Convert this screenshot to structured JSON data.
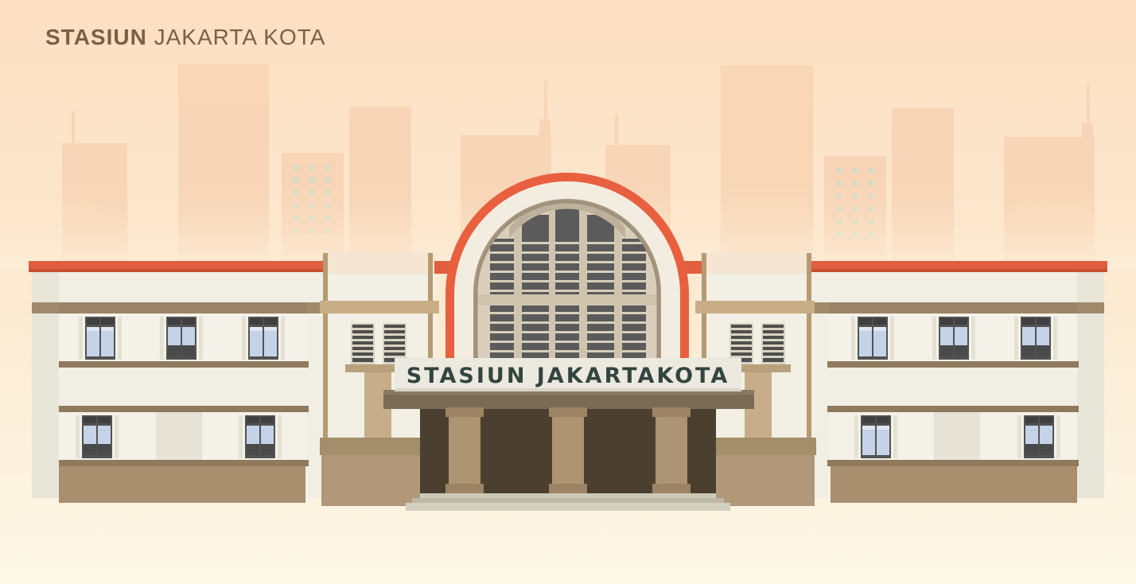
{
  "title": {
    "bold": "STASIUN",
    "light": "JAKARTA KOTA"
  },
  "sign": {
    "text": "STASIUN JAKARTAKOTA"
  },
  "colors": {
    "sky_top": "#fde0c2",
    "sky_bottom": "#fdf8e8",
    "skyline": "#f7d3b3",
    "roof_red": "#e05f40",
    "wall": "#f2efe3",
    "trim_brown": "#a18a6b",
    "plinth": "#ad9674",
    "entrance_dark": "#4a3f2c",
    "pillar": "#ad9573",
    "sign_bg": "#eceae0",
    "sign_text": "#34453f",
    "title_text": "#7b5f42",
    "window_glass": "#c3d2e7",
    "window_frame": "#505050"
  }
}
